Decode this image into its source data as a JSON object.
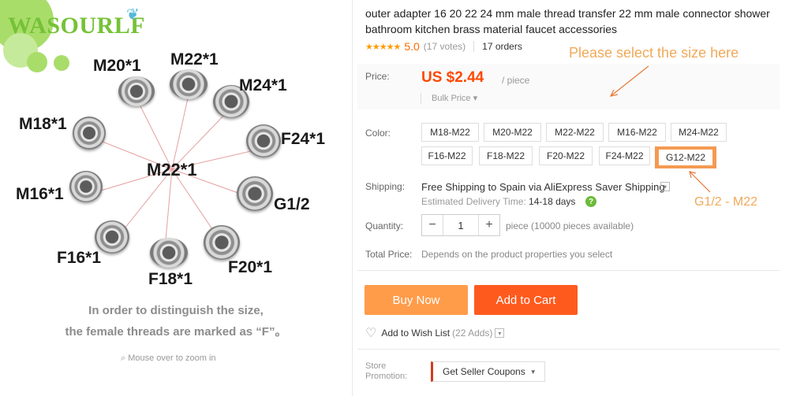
{
  "image": {
    "brand": "WASOURLF",
    "center_label": "M22*1",
    "parts": [
      "M20*1",
      "M22*1",
      "M24*1",
      "M18*1",
      "F24*1",
      "M16*1",
      "G1/2",
      "F16*1",
      "F18*1",
      "F20*1"
    ],
    "note_line1": "In order to distinguish the size,",
    "note_line2": "the female threads are marked as “F”。",
    "zoom_hint": "Mouse over to zoom in",
    "brand_color": "#76c236"
  },
  "product": {
    "title": "outer adapter 16 20 22 24 mm male thread transfer 22 mm male connector shower bathroom kitchen brass material faucet accessories",
    "stars": "★★★★★",
    "score": "5.0",
    "votes": "(17 votes)",
    "orders": "17 orders"
  },
  "annotations": {
    "select_hint": "Please select the size here",
    "selected_note": "G1/2 - M22",
    "color": "#f0a95a"
  },
  "price": {
    "label": "Price:",
    "value": "US $2.44",
    "unit": "/ piece",
    "bulk": "Bulk Price",
    "color": "#ff4800"
  },
  "color_options": {
    "label": "Color:",
    "row1": [
      "M18-M22",
      "M20-M22",
      "M22-M22",
      "M16-M22",
      "M24-M22"
    ],
    "row2": [
      "F16-M22",
      "F18-M22",
      "F20-M22",
      "F24-M22",
      "G12-M22"
    ],
    "selected": "G12-M22"
  },
  "shipping": {
    "label": "Shipping:",
    "text": "Free Shipping to Spain via AliExpress Saver Shipping",
    "delivery_label": "Estimated Delivery Time:",
    "delivery_days": "14-18 days"
  },
  "quantity": {
    "label": "Quantity:",
    "value": "1",
    "available": "piece (10000 pieces available)"
  },
  "total": {
    "label": "Total Price:",
    "value": "Depends on the product properties you select"
  },
  "actions": {
    "buy_now": "Buy Now",
    "add_to_cart": "Add to Cart",
    "wishlist": "Add to Wish List",
    "wishlist_adds": "(22 Adds)"
  },
  "store": {
    "label_line1": "Store",
    "label_line2": "Promotion:",
    "coupons": "Get Seller Coupons"
  }
}
